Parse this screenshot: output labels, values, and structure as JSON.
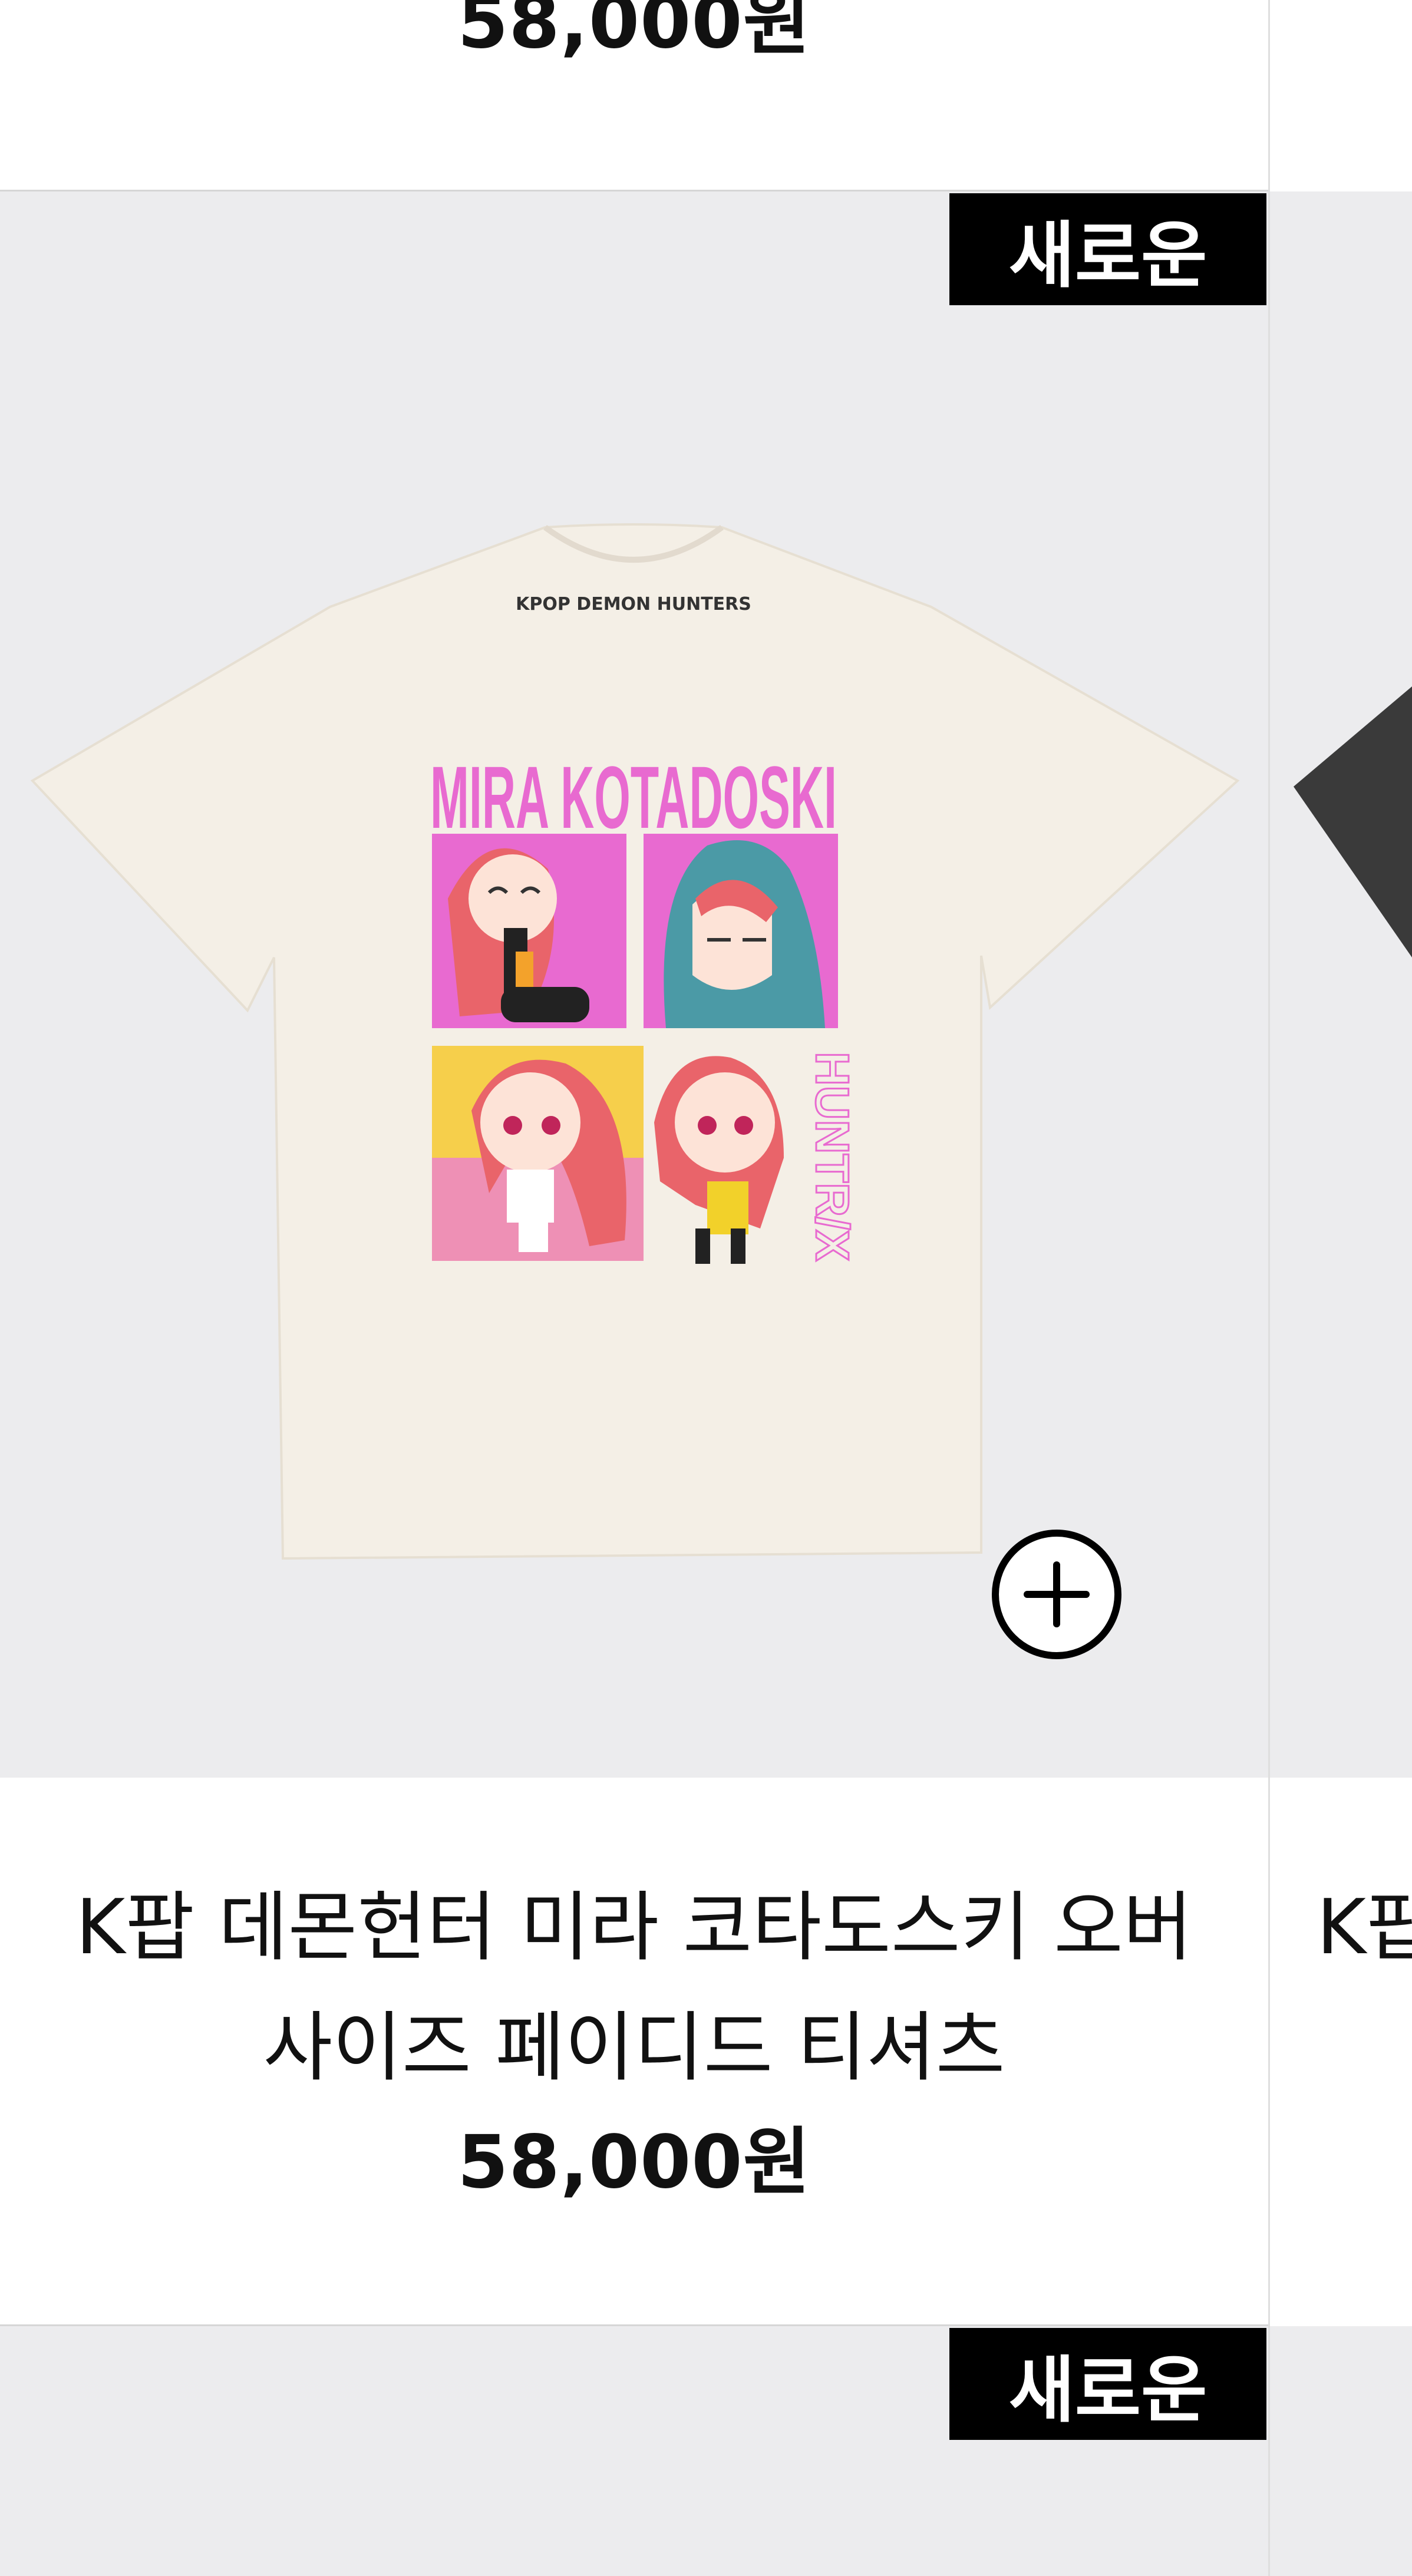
{
  "products": [
    {
      "price": "58,000원"
    },
    {
      "badge": "새로운",
      "name_line1": "K팝 데몬헌터 미라 코타도스키 오버",
      "name_line2": "사이즈 페이디드 티셔츠",
      "price": "58,000원",
      "image": {
        "shirt_label": "KPOP DEMON HUNTERS",
        "print_title": "MIRA KOTADOSKI",
        "side_text": "HUNTR/X"
      },
      "add_icon": "plus-circle-icon"
    },
    {
      "badge": "새로운"
    }
  ],
  "right_peek": {
    "title_fragment": "K팝"
  },
  "colors": {
    "image_bg": "#ececee",
    "badge_bg": "#000000",
    "badge_text": "#ffffff",
    "print_pink": "#e86ad0",
    "shirt": "#f4efe6"
  }
}
